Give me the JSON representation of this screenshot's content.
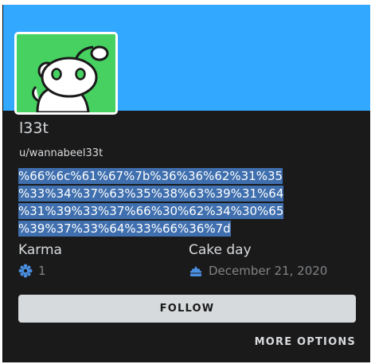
{
  "profile": {
    "display_name": "l33t",
    "username": "u/wannabeel33t",
    "bio": "%66%6c%61%67%7b%36%36%62%31%35%33%34%37%63%35%38%63%39%31%64%31%39%33%37%66%30%62%34%30%65%39%37%33%64%33%66%36%7d",
    "bio_lines": [
      "%66%6c%61%67%7b%36%36%62%31%35",
      "%33%34%37%63%35%38%63%39%31%64",
      "%31%39%33%37%66%30%62%34%30%65",
      "%39%37%33%64%33%66%36%7d"
    ]
  },
  "stats": {
    "karma_label": "Karma",
    "karma_value": "1",
    "karma_icon": "karma-icon",
    "cake_label": "Cake day",
    "cake_value": "December 21, 2020",
    "cake_icon": "cake-icon"
  },
  "actions": {
    "follow_label": "FOLLOW",
    "more_options_label": "MORE OPTIONS"
  },
  "colors": {
    "banner": "#33a8ff",
    "card_bg": "#1a1a1b",
    "avatar_bg": "#46d160",
    "text_primary": "#d7dadc",
    "text_muted": "#818384",
    "selection": "#3f6fae",
    "button_bg": "#d7dadc",
    "karma_icon": "#4a90e2",
    "cake_icon": "#4a90e2"
  }
}
